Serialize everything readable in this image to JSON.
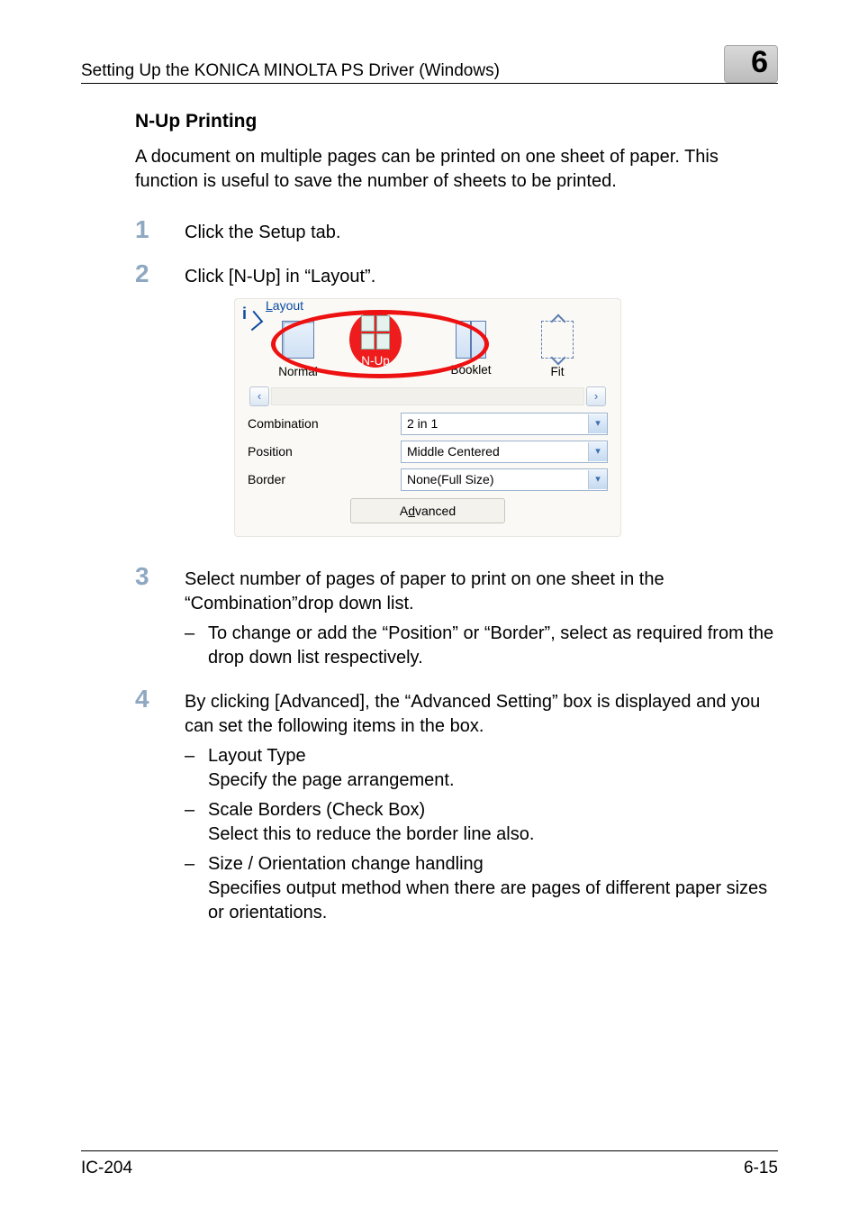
{
  "header": {
    "running_head": "Setting Up the KONICA MINOLTA PS Driver (Windows)",
    "chapter_number": "6"
  },
  "section": {
    "title": "N-Up Printing",
    "intro": "A document on multiple pages can be printed on one sheet of paper. This function is useful to save the number of sheets to be printed."
  },
  "steps": {
    "s1": {
      "num": "1",
      "text": "Click the Setup tab."
    },
    "s2": {
      "num": "2",
      "text": "Click [N-Up] in “Layout”."
    },
    "s3": {
      "num": "3",
      "text": "Select number of pages of paper to print on one sheet in the “Combination”drop down list.",
      "sub1": "To change or add the “Position” or “Border”, select as required from the drop down list respectively."
    },
    "s4": {
      "num": "4",
      "text": "By clicking [Advanced], the “Advanced Setting” box is displayed and you can set the following items in the box.",
      "i1_title": "Layout Type",
      "i1_desc": "Specify the page arrangement.",
      "i2_title": "Scale Borders (Check Box)",
      "i2_desc": "Select this to reduce the border line also.",
      "i3_title": "Size / Orientation change handling",
      "i3_desc": "Specifies output method when there are pages of different paper sizes or orientations."
    }
  },
  "dialog": {
    "group_label": "Layout",
    "thumbs": {
      "normal": "Normal",
      "nup": "N-Up",
      "booklet": "Booklet",
      "fit": "Fit"
    },
    "scroll_left": "‹",
    "scroll_right": "›",
    "rows": {
      "combination_label": "Combination",
      "combination_value": "2 in 1",
      "position_label": "Position",
      "position_value": "Middle Centered",
      "border_label": "Border",
      "border_value": "None(Full Size)"
    },
    "advanced_btn": "Advanced",
    "advanced_accesskey": "d",
    "combo_arrow": "▾"
  },
  "footer": {
    "left": "IC-204",
    "right": "6-15"
  },
  "dash": "–"
}
